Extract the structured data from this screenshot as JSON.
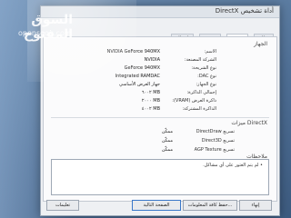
{
  "window": {
    "title": "DirectX أداة تشخيص"
  },
  "tabs": [
    {
      "label": "نظام"
    },
    {
      "label": "عرض"
    },
    {
      "label": "صوت"
    },
    {
      "label": "إدخال"
    }
  ],
  "device": {
    "group_title": "الجهاز",
    "rows": [
      {
        "label": "الاسم:",
        "value": "NVIDIA GeForce 940MX"
      },
      {
        "label": "الشركة المصنعة:",
        "value": "NVIDIA"
      },
      {
        "label": "نوع الشريحة:",
        "value": "GeForce 940MX"
      },
      {
        "label": "نوع DAC:",
        "value": "Integrated RAMDAC"
      },
      {
        "label": "نوع الجهاز:",
        "value": "جهاز العرض الأساسي"
      },
      {
        "label": "إجمالي الذاكرة:",
        "value": "MB ٦٠٠٢"
      },
      {
        "label": "ذاكرة العرض (VRAM):",
        "value": "MB ٢٠٠٠"
      },
      {
        "label": "الذاكرة المشتركة:",
        "value": "MB ٤٠٠٢"
      }
    ]
  },
  "features": {
    "group_title": "ميزات DirectX",
    "rows": [
      {
        "label": "تسريع DirectDraw",
        "value": "ممكّن"
      },
      {
        "label": "تسريع Direct3D",
        "value": "ممكّن"
      },
      {
        "label": "تسريع AGP Texture",
        "value": "ممكّن"
      }
    ]
  },
  "notes": {
    "group_title": "ملاحظات",
    "items": [
      "لم يتم العثور على أي مشاكل."
    ]
  },
  "buttons": {
    "help": "تعليمات",
    "next_page": "الصفحة التالية",
    "save_all": "حفظ كافة المعلومات...",
    "exit": "إنهاء"
  },
  "watermark": {
    "arabic": "السوق المفتوح",
    "latin": "opensooq.com"
  }
}
